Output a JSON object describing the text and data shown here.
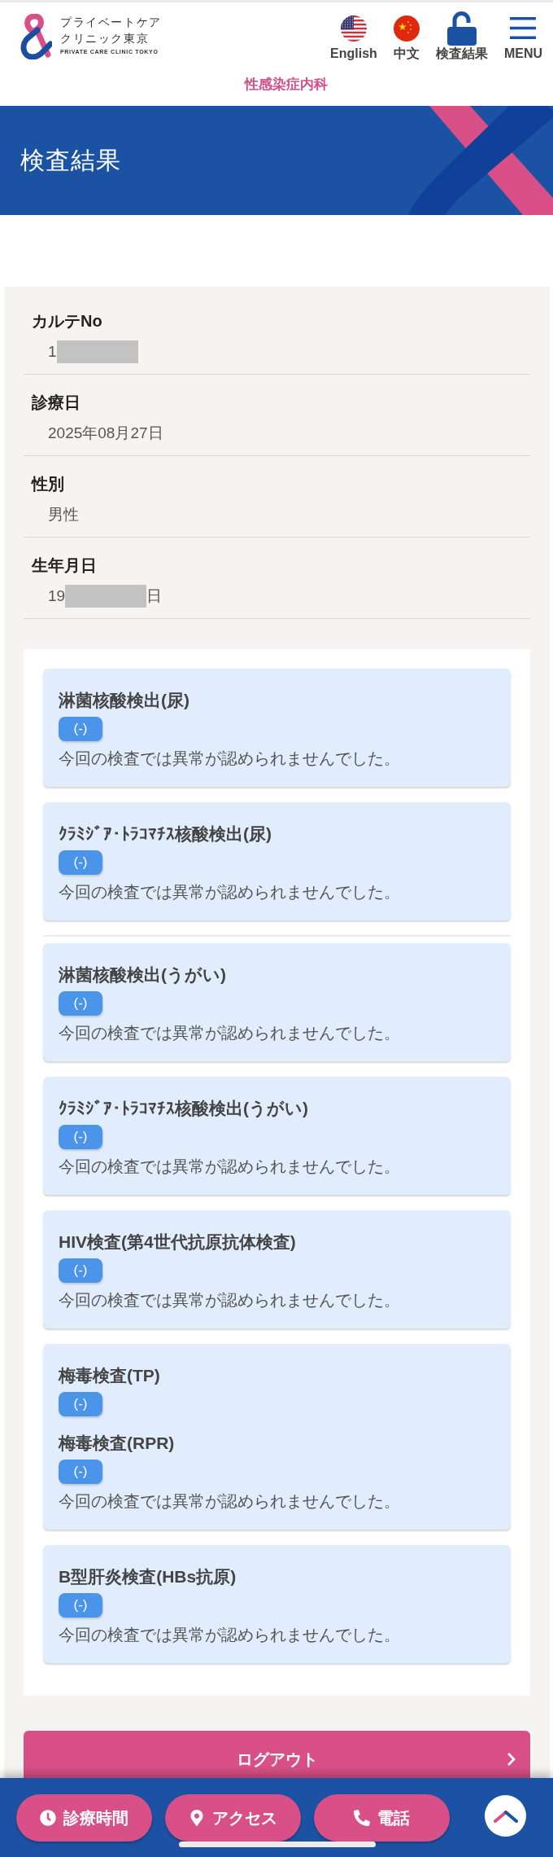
{
  "header": {
    "logo": {
      "name_lines": [
        "プライベートケア",
        "クリニック東京"
      ],
      "tagline": "PRIVATE CARE CLINIC TOKYO"
    },
    "nav": [
      {
        "kind": "us_flag",
        "label": "English"
      },
      {
        "kind": "cn_flag",
        "label": "中文"
      },
      {
        "kind": "lock",
        "label": "検査結果"
      },
      {
        "kind": "menu",
        "label": "MENU"
      }
    ],
    "department": "性感染症内科"
  },
  "banner": {
    "title": "検査結果"
  },
  "patient_info": [
    {
      "label": "カルテNo",
      "value": [
        {
          "kind": "text",
          "text": "1"
        },
        {
          "kind": "redaction"
        }
      ]
    },
    {
      "label": "診療日",
      "value": [
        {
          "kind": "text",
          "text": "2025年08月27日"
        }
      ]
    },
    {
      "label": "性別",
      "value": [
        {
          "kind": "text",
          "text": "男性"
        }
      ]
    },
    {
      "label": "生年月日",
      "value": [
        {
          "kind": "text",
          "text": "19"
        },
        {
          "kind": "redaction"
        },
        {
          "kind": "text",
          "text": "日"
        }
      ]
    }
  ],
  "result_groups": [
    {
      "cards": [
        {
          "tests": [
            {
              "name": "淋菌核酸検出(尿)",
              "result": "(-)"
            }
          ],
          "message": "今回の検査では異常が認められませんでした。"
        },
        {
          "tests": [
            {
              "name": "ｸﾗﾐｼﾞｱ･ﾄﾗｺﾏﾁｽ核酸検出(尿)",
              "result": "(-)"
            }
          ],
          "message": "今回の検査では異常が認められませんでした。"
        }
      ]
    },
    {
      "cards": [
        {
          "tests": [
            {
              "name": "淋菌核酸検出(うがい)",
              "result": "(-)"
            }
          ],
          "message": "今回の検査では異常が認められませんでした。"
        },
        {
          "tests": [
            {
              "name": "ｸﾗﾐｼﾞｱ･ﾄﾗｺﾏﾁｽ核酸検出(うがい)",
              "result": "(-)"
            }
          ],
          "message": "今回の検査では異常が認められませんでした。"
        },
        {
          "tests": [
            {
              "name": "HIV検査(第4世代抗原抗体検査)",
              "result": "(-)"
            }
          ],
          "message": "今回の検査では異常が認められませんでした。"
        },
        {
          "tests": [
            {
              "name": "梅毒検査(TP)",
              "result": "(-)"
            },
            {
              "name": "梅毒検査(RPR)",
              "result": "(-)"
            }
          ],
          "message": "今回の検査では異常が認められませんでした。"
        },
        {
          "tests": [
            {
              "name": "B型肝炎検査(HBs抗原)",
              "result": "(-)"
            }
          ],
          "message": "今回の検査では異常が認められませんでした。"
        }
      ]
    }
  ],
  "logout_button": {
    "label": "ログアウト"
  },
  "bottom_bar": {
    "actions": [
      {
        "kind": "clock",
        "label": "診療時間"
      },
      {
        "kind": "pin",
        "label": "アクセス"
      },
      {
        "kind": "phone",
        "label": "電話"
      }
    ]
  }
}
